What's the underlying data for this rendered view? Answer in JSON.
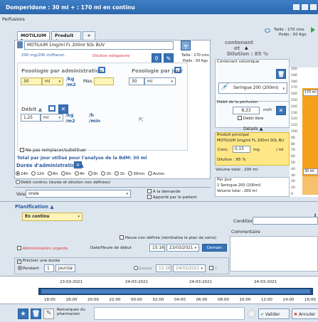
{
  "title": "Domperidone : 30 ml + : 170 ml en continu",
  "section_perfusions": "Perfusions",
  "patient": {
    "height": "Taille : 170 cms",
    "weight": "Poids : 50 Kgs"
  },
  "tabs": [
    "MOTILIUM *",
    "Produit +",
    "+"
  ],
  "product": {
    "name": "MOTILIUM 1mg/ml FL 200ml SOL BUV",
    "concentration": "200 mg/200 ml/flacon",
    "dilution_note": "Dilution obligatoire",
    "taille": "Taille : 170 cms",
    "poids": "Poids : 50 Kgs"
  },
  "posologie": {
    "label_admin": "Posologie par administration",
    "label_day": "Posologie par jour",
    "value_admin": "30",
    "unit_admin": "ml",
    "per_unit": "/kg",
    "per_m2": "/m2",
    "max_label": "Max.",
    "value_day": "30",
    "unit_day": "ml"
  },
  "debit": {
    "label": "Débit",
    "value": "1,25",
    "unit": "ml",
    "per_kg": "/kg",
    "per_m2": "/m2",
    "h": "/h",
    "min": "/min"
  },
  "no_substitute": "Ne pas remplacer/substituer",
  "total_day": "Total par jour utilisé pour l'analyse de la BdM: 30 ml",
  "contenant": {
    "title": "contenant",
    "et": "et",
    "dilution": "Dilution : 85 %",
    "volumic_title": "Contenant volumique",
    "syringe": "Seringue 200 (200ml)",
    "debit_title": "Débit de la perfusion",
    "debit_value": "8,33",
    "debit_unit": "ml/h",
    "debit_libre": "Débit libre",
    "details": "Détails",
    "principal_title": "Produit principal",
    "principal_name": "MOTILIUM 1mg/ml FL 200ml SOL BU",
    "conc_label": "Conc.",
    "conc_value": "0,15",
    "conc_unit": "mg",
    "conc_per": "/ ml",
    "volume_total": "Volume total : 200 ml",
    "par_jour": "Par jour",
    "par_jour_1": "1 Seringue 200 (200ml)",
    "par_jour_2": "Volume total : 200 ml"
  },
  "gauge": {
    "ticks": [
      "200",
      "190",
      "180",
      "170",
      "160",
      "150",
      "140",
      "130",
      "120",
      "110",
      "100",
      "90",
      "80",
      "70",
      "60",
      "50",
      "40",
      "30",
      "20",
      "10",
      "0"
    ],
    "top_label": "170 ml",
    "bottom_label": "30 ml",
    "top_value": 170,
    "bottom_value": 30,
    "max": 200
  },
  "duree": {
    "title": "Durée d'administration",
    "options": [
      "24h",
      "12h",
      "8h",
      "6h",
      "4h",
      "3h",
      "2h",
      "1h",
      "30mn",
      "Autre:"
    ],
    "continu": "Débit continu (durée et dilution non définies)"
  },
  "voie": {
    "label": "Voie",
    "value": "orale",
    "demande": "A la demande",
    "apporte": "Apporté par le patient"
  },
  "planification": {
    "title": "Planification",
    "mode": "En continu",
    "condition": "Condition",
    "commentaire": "Commentaire",
    "heure_non_def": "Heure non définie (réinitialise le plan de soins)",
    "urgent": "Administration urgente",
    "debut_label": "Date/Heure de début",
    "debut_time": "15:16",
    "debut_date": "23/03/2021",
    "demain": "Demain",
    "preciser": "Préciser une durée",
    "pendant": "Pendant",
    "pendant_value": "1",
    "pendant_unit": "jour(s)",
    "jusque": "Jusque",
    "jusque_time": "15:16",
    "jusque_date": "24/03/2021",
    "j_label": "J"
  },
  "timeline": {
    "dates": [
      "23-03-2021",
      "24-03-2021",
      "24-03-2021",
      "24-03-2021"
    ],
    "hours": [
      "18:00",
      "18:00",
      "20:00",
      "22:00",
      "00:00",
      "02:00",
      "04:00",
      "06:00",
      "08:00",
      "10:00",
      "12:00",
      "14:00",
      "16:00"
    ]
  },
  "footer": {
    "remarques": "Remarques du pharmacien",
    "valider": "Valider",
    "annuler": "Annuler"
  },
  "colors": {
    "accent": "#3672b7",
    "syringe_fill": "#f5a01a",
    "highlight": "#fff4b8"
  }
}
